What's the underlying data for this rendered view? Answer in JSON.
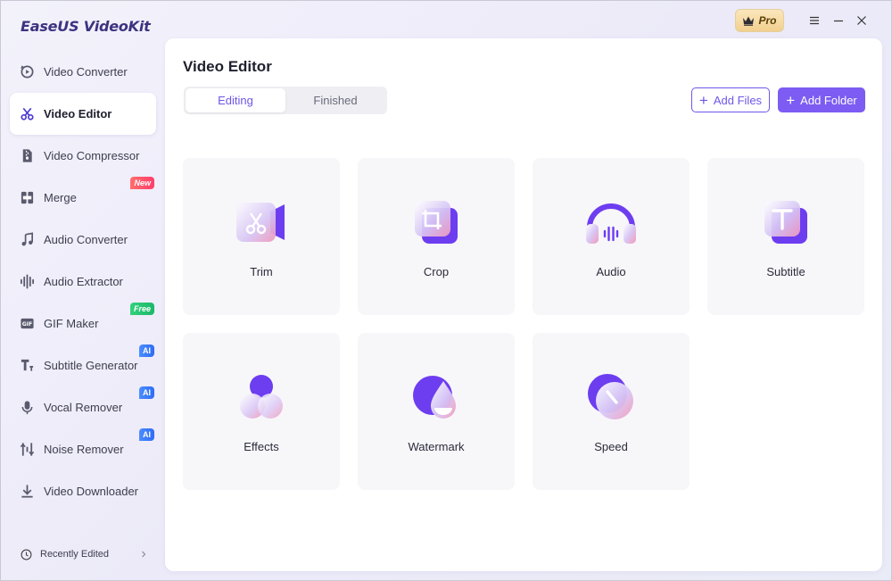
{
  "app": {
    "title": "EaseUS VideoKit",
    "pro_label": "Pro"
  },
  "sidebar": {
    "items": [
      {
        "label": "Video Converter",
        "icon": "video-converter-icon"
      },
      {
        "label": "Video Editor",
        "icon": "scissors-icon",
        "active": true
      },
      {
        "label": "Video Compressor",
        "icon": "compress-file-icon"
      },
      {
        "label": "Merge",
        "icon": "merge-icon",
        "tag": "New"
      },
      {
        "label": "Audio Converter",
        "icon": "music-note-icon"
      },
      {
        "label": "Audio Extractor",
        "icon": "waveform-icon"
      },
      {
        "label": "GIF Maker",
        "icon": "gif-icon",
        "tag": "Free"
      },
      {
        "label": "Subtitle Generator",
        "icon": "subtitle-icon",
        "tag": "AI"
      },
      {
        "label": "Vocal Remover",
        "icon": "microphone-icon",
        "tag": "AI"
      },
      {
        "label": "Noise Remover",
        "icon": "noise-icon",
        "tag": "AI"
      },
      {
        "label": "Video Downloader",
        "icon": "download-icon"
      }
    ],
    "recent_label": "Recently Edited"
  },
  "main": {
    "title": "Video Editor",
    "tabs": [
      {
        "label": "Editing",
        "active": true
      },
      {
        "label": "Finished"
      }
    ],
    "add_files": "Add Files",
    "add_folder": "Add Folder",
    "tools": [
      {
        "label": "Trim",
        "icon": "trim-icon"
      },
      {
        "label": "Crop",
        "icon": "crop-icon"
      },
      {
        "label": "Audio",
        "icon": "headphones-icon"
      },
      {
        "label": "Subtitle",
        "icon": "text-t-icon"
      },
      {
        "label": "Effects",
        "icon": "effects-circles-icon"
      },
      {
        "label": "Watermark",
        "icon": "watermark-drop-icon"
      },
      {
        "label": "Speed",
        "icon": "speed-gauge-icon"
      }
    ]
  },
  "colors": {
    "accent": "#7c5cf2",
    "brand": "#3b3380"
  }
}
